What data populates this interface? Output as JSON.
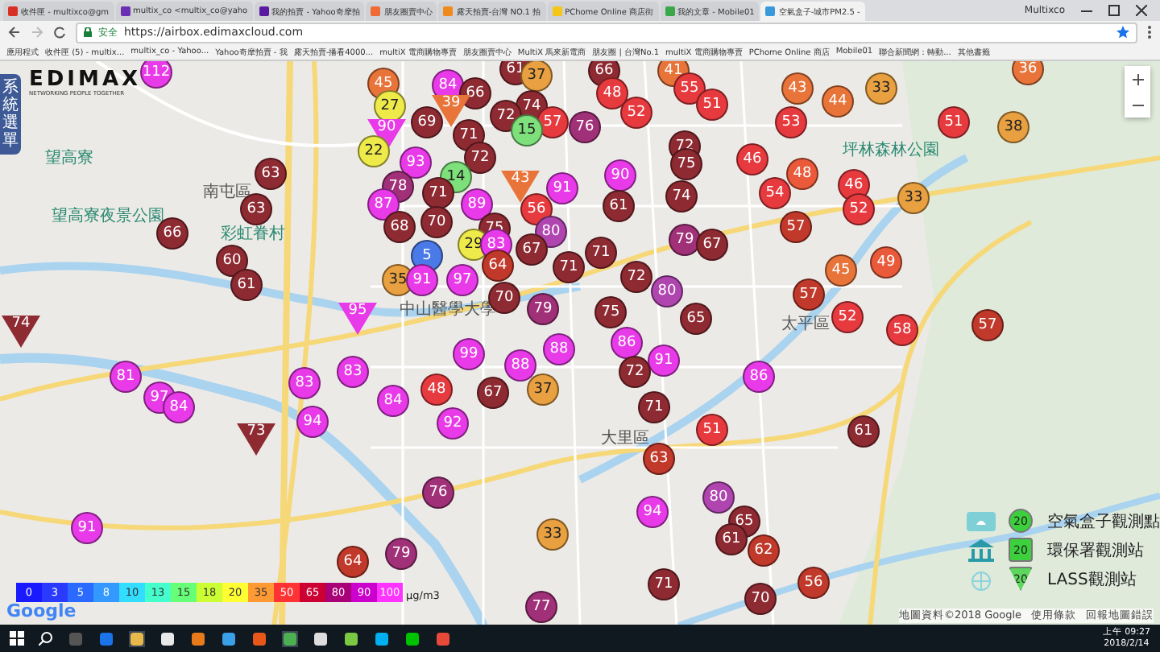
{
  "browser": {
    "tabs": [
      {
        "title": "收件匣 - multixco@gm",
        "selected": false,
        "color": "#d93025"
      },
      {
        "title": "multix_co <multix_co@yaho",
        "selected": false,
        "color": "#6b2fb3"
      },
      {
        "title": "我的拍賣 - Yahoo奇摩拍",
        "selected": false,
        "color": "#5a1aa0"
      },
      {
        "title": "朋友圈賣中心",
        "selected": false,
        "color": "#f06a35"
      },
      {
        "title": "露天拍賣-台灣 NO.1 拍",
        "selected": false,
        "color": "#f08a1a"
      },
      {
        "title": "PChome Online 商店街",
        "selected": false,
        "color": "#f5c518"
      },
      {
        "title": "我的文章 - Mobile01",
        "selected": false,
        "color": "#3aa84a"
      },
      {
        "title": "空氣盒子-城市PM2.5 -",
        "selected": true,
        "color": "#3a9ad9"
      }
    ],
    "user": "Multixco",
    "secure_label": "安全",
    "url": "https://airbox.edimaxcloud.com",
    "bookmarks": [
      "應用程式",
      "收件匣 (5) - multix...",
      "multix_co - Yahoo...",
      "Yahoo奇摩拍賣 - 我",
      "露天拍賣-播看4000...",
      "multiX 電商購物專賣",
      "朋友圈賣中心",
      "MultiX 馬來新電商",
      "朋友圈 | 台灣No.1",
      "multiX 電商購物專賣",
      "PChome Online 商店",
      "Mobile01",
      "聯合新聞網：轉動...",
      "其他書籤"
    ]
  },
  "map": {
    "logo": "EDIMAX",
    "logo_tagline": "NETWORKING PEOPLE TOGETHER",
    "menu_tab": "系統選單",
    "places": [
      {
        "name": "望高寮",
        "kind": "park"
      },
      {
        "name": "望高寮夜景公園",
        "kind": "park"
      },
      {
        "name": "南屯區",
        "kind": "district"
      },
      {
        "name": "彩虹眷村",
        "kind": "park"
      },
      {
        "name": "中山醫學大學",
        "kind": "district"
      },
      {
        "name": "坪林森林公園",
        "kind": "park"
      },
      {
        "name": "太平區",
        "kind": "district"
      },
      {
        "name": "大里區",
        "kind": "district"
      }
    ],
    "markers": [
      {
        "value": "112",
        "color": "#e83ae8",
        "kind": "circle"
      },
      {
        "value": "61",
        "color": "#8e2a32",
        "kind": "circle"
      },
      {
        "value": "37",
        "color": "#e8a040",
        "kind": "circle"
      },
      {
        "value": "45",
        "color": "#e8743a",
        "kind": "circle"
      },
      {
        "value": "84",
        "color": "#e83ae8",
        "kind": "circle"
      },
      {
        "value": "66",
        "color": "#8e2a32",
        "kind": "circle"
      },
      {
        "value": "27",
        "color": "#eeea4a",
        "kind": "circle"
      },
      {
        "value": "39",
        "color": "#e8743a",
        "kind": "triangle"
      },
      {
        "value": "74",
        "color": "#8e2a32",
        "kind": "circle"
      },
      {
        "value": "57",
        "color": "#e63a3f",
        "kind": "circle"
      },
      {
        "value": "72",
        "color": "#8e2a32",
        "kind": "circle"
      },
      {
        "value": "69",
        "color": "#8e2a32",
        "kind": "circle"
      },
      {
        "value": "71",
        "color": "#8e2a32",
        "kind": "circle"
      },
      {
        "value": "90",
        "color": "#e83ae8",
        "kind": "triangle"
      },
      {
        "value": "15",
        "color": "#7ee07a",
        "kind": "circle"
      },
      {
        "value": "22",
        "color": "#eeea4a",
        "kind": "circle"
      },
      {
        "value": "72",
        "color": "#8e2a32",
        "kind": "circle"
      },
      {
        "value": "93",
        "color": "#e83ae8",
        "kind": "circle"
      },
      {
        "value": "14",
        "color": "#7ee07a",
        "kind": "circle"
      },
      {
        "value": "78",
        "color": "#a03078",
        "kind": "circle"
      },
      {
        "value": "43",
        "color": "#e8743a",
        "kind": "triangle"
      },
      {
        "value": "71",
        "color": "#8e2a32",
        "kind": "circle"
      },
      {
        "value": "91",
        "color": "#e83ae8",
        "kind": "circle"
      },
      {
        "value": "56",
        "color": "#e63a3f",
        "kind": "circle"
      },
      {
        "value": "87",
        "color": "#e83ae8",
        "kind": "circle"
      },
      {
        "value": "89",
        "color": "#e83ae8",
        "kind": "circle"
      },
      {
        "value": "75",
        "color": "#8e2a32",
        "kind": "circle"
      },
      {
        "value": "70",
        "color": "#8e2a32",
        "kind": "circle"
      },
      {
        "value": "68",
        "color": "#8e2a32",
        "kind": "circle"
      },
      {
        "value": "80",
        "color": "#b045b0",
        "kind": "circle"
      },
      {
        "value": "5",
        "color": "#4a7ae8",
        "kind": "circle"
      },
      {
        "value": "29",
        "color": "#eeea4a",
        "kind": "circle"
      },
      {
        "value": "83",
        "color": "#e83ae8",
        "kind": "circle"
      },
      {
        "value": "67",
        "color": "#8e2a32",
        "kind": "circle"
      },
      {
        "value": "64",
        "color": "#c0392b",
        "kind": "circle"
      },
      {
        "value": "35",
        "color": "#e8a040",
        "kind": "circle"
      },
      {
        "value": "91",
        "color": "#e83ae8",
        "kind": "circle"
      },
      {
        "value": "97",
        "color": "#e83ae8",
        "kind": "circle"
      },
      {
        "value": "70",
        "color": "#8e2a32",
        "kind": "circle"
      },
      {
        "value": "71",
        "color": "#8e2a32",
        "kind": "circle"
      },
      {
        "value": "79",
        "color": "#a03078",
        "kind": "circle"
      },
      {
        "value": "63",
        "color": "#8e2a32",
        "kind": "circle"
      },
      {
        "value": "63",
        "color": "#8e2a32",
        "kind": "circle"
      },
      {
        "value": "66",
        "color": "#8e2a32",
        "kind": "circle"
      },
      {
        "value": "60",
        "color": "#8e2a32",
        "kind": "circle"
      },
      {
        "value": "61",
        "color": "#8e2a32",
        "kind": "circle"
      },
      {
        "value": "74",
        "color": "#8e2a32",
        "kind": "triangle"
      },
      {
        "value": "66",
        "color": "#8e2a32",
        "kind": "circle"
      },
      {
        "value": "41",
        "color": "#e8743a",
        "kind": "circle"
      },
      {
        "value": "48",
        "color": "#e63a3f",
        "kind": "circle"
      },
      {
        "value": "55",
        "color": "#e63a3f",
        "kind": "circle"
      },
      {
        "value": "51",
        "color": "#e63a3f",
        "kind": "circle"
      },
      {
        "value": "52",
        "color": "#e63a3f",
        "kind": "circle"
      },
      {
        "value": "76",
        "color": "#a03078",
        "kind": "circle"
      },
      {
        "value": "43",
        "color": "#e8743a",
        "kind": "circle"
      },
      {
        "value": "44",
        "color": "#e8743a",
        "kind": "circle"
      },
      {
        "value": "33",
        "color": "#e8a040",
        "kind": "circle"
      },
      {
        "value": "36",
        "color": "#e8743a",
        "kind": "circle"
      },
      {
        "value": "51",
        "color": "#e63a3f",
        "kind": "circle"
      },
      {
        "value": "38",
        "color": "#e8a040",
        "kind": "circle"
      },
      {
        "value": "53",
        "color": "#e63a3f",
        "kind": "circle"
      },
      {
        "value": "72",
        "color": "#8e2a32",
        "kind": "circle"
      },
      {
        "value": "75",
        "color": "#8e2a32",
        "kind": "circle"
      },
      {
        "value": "46",
        "color": "#e63a3f",
        "kind": "circle"
      },
      {
        "value": "90",
        "color": "#e83ae8",
        "kind": "circle"
      },
      {
        "value": "48",
        "color": "#ea5a3a",
        "kind": "circle"
      },
      {
        "value": "46",
        "color": "#e63a3f",
        "kind": "circle"
      },
      {
        "value": "74",
        "color": "#8e2a32",
        "kind": "circle"
      },
      {
        "value": "54",
        "color": "#e63a3f",
        "kind": "circle"
      },
      {
        "value": "61",
        "color": "#8e2a32",
        "kind": "circle"
      },
      {
        "value": "52",
        "color": "#e63a3f",
        "kind": "circle"
      },
      {
        "value": "33",
        "color": "#e8a040",
        "kind": "circle"
      },
      {
        "value": "57",
        "color": "#c0392b",
        "kind": "circle"
      },
      {
        "value": "79",
        "color": "#a03078",
        "kind": "circle"
      },
      {
        "value": "67",
        "color": "#8e2a32",
        "kind": "circle"
      },
      {
        "value": "71",
        "color": "#8e2a32",
        "kind": "circle"
      },
      {
        "value": "49",
        "color": "#ea5a3a",
        "kind": "circle"
      },
      {
        "value": "45",
        "color": "#e8743a",
        "kind": "circle"
      },
      {
        "value": "72",
        "color": "#8e2a32",
        "kind": "circle"
      },
      {
        "value": "80",
        "color": "#b045b0",
        "kind": "circle"
      },
      {
        "value": "57",
        "color": "#c0392b",
        "kind": "circle"
      },
      {
        "value": "75",
        "color": "#8e2a32",
        "kind": "circle"
      },
      {
        "value": "65",
        "color": "#8e2a32",
        "kind": "circle"
      },
      {
        "value": "52",
        "color": "#e63a3f",
        "kind": "circle"
      },
      {
        "value": "58",
        "color": "#e63a3f",
        "kind": "circle"
      },
      {
        "value": "57",
        "color": "#c0392b",
        "kind": "circle"
      },
      {
        "value": "95",
        "color": "#e83ae8",
        "kind": "triangle"
      },
      {
        "value": "99",
        "color": "#e83ae8",
        "kind": "circle"
      },
      {
        "value": "88",
        "color": "#e83ae8",
        "kind": "circle"
      },
      {
        "value": "88",
        "color": "#e83ae8",
        "kind": "circle"
      },
      {
        "value": "81",
        "color": "#e83ae8",
        "kind": "circle"
      },
      {
        "value": "97",
        "color": "#e83ae8",
        "kind": "circle"
      },
      {
        "value": "84",
        "color": "#e83ae8",
        "kind": "circle"
      },
      {
        "value": "83",
        "color": "#e83ae8",
        "kind": "circle"
      },
      {
        "value": "83",
        "color": "#e83ae8",
        "kind": "circle"
      },
      {
        "value": "48",
        "color": "#e63a3f",
        "kind": "circle"
      },
      {
        "value": "67",
        "color": "#8e2a32",
        "kind": "circle"
      },
      {
        "value": "37",
        "color": "#e8a040",
        "kind": "circle"
      },
      {
        "value": "84",
        "color": "#e83ae8",
        "kind": "circle"
      },
      {
        "value": "94",
        "color": "#e83ae8",
        "kind": "circle"
      },
      {
        "value": "92",
        "color": "#e83ae8",
        "kind": "circle"
      },
      {
        "value": "73",
        "color": "#8e2a32",
        "kind": "triangle"
      },
      {
        "value": "76",
        "color": "#a03078",
        "kind": "circle"
      },
      {
        "value": "91",
        "color": "#e83ae8",
        "kind": "circle"
      },
      {
        "value": "33",
        "color": "#e8a040",
        "kind": "circle"
      },
      {
        "value": "64",
        "color": "#c0392b",
        "kind": "circle"
      },
      {
        "value": "79",
        "color": "#a03078",
        "kind": "circle"
      },
      {
        "value": "77",
        "color": "#a03078",
        "kind": "circle"
      },
      {
        "value": "86",
        "color": "#e83ae8",
        "kind": "circle"
      },
      {
        "value": "91",
        "color": "#e83ae8",
        "kind": "circle"
      },
      {
        "value": "72",
        "color": "#8e2a32",
        "kind": "circle"
      },
      {
        "value": "71",
        "color": "#8e2a32",
        "kind": "circle"
      },
      {
        "value": "86",
        "color": "#e83ae8",
        "kind": "circle"
      },
      {
        "value": "51",
        "color": "#e63a3f",
        "kind": "circle"
      },
      {
        "value": "61",
        "color": "#8e2a32",
        "kind": "circle"
      },
      {
        "value": "63",
        "color": "#c0392b",
        "kind": "circle"
      },
      {
        "value": "80",
        "color": "#b045b0",
        "kind": "circle"
      },
      {
        "value": "94",
        "color": "#e83ae8",
        "kind": "circle"
      },
      {
        "value": "65",
        "color": "#8e2a32",
        "kind": "circle"
      },
      {
        "value": "61",
        "color": "#8e2a32",
        "kind": "circle"
      },
      {
        "value": "62",
        "color": "#c0392b",
        "kind": "circle"
      },
      {
        "value": "71",
        "color": "#8e2a32",
        "kind": "circle"
      },
      {
        "value": "56",
        "color": "#c0392b",
        "kind": "circle"
      },
      {
        "value": "70",
        "color": "#8e2a32",
        "kind": "circle"
      }
    ],
    "scale": [
      {
        "label": "0",
        "color": "#1a1aff"
      },
      {
        "label": "3",
        "color": "#2a3aff"
      },
      {
        "label": "5",
        "color": "#2a6aff"
      },
      {
        "label": "8",
        "color": "#3399ff"
      },
      {
        "label": "10",
        "color": "#33ddff"
      },
      {
        "label": "13",
        "color": "#44ffcc"
      },
      {
        "label": "15",
        "color": "#66ff77"
      },
      {
        "label": "18",
        "color": "#ccff33"
      },
      {
        "label": "20",
        "color": "#ffff33"
      },
      {
        "label": "35",
        "color": "#ff9933"
      },
      {
        "label": "50",
        "color": "#ff3333"
      },
      {
        "label": "65",
        "color": "#cc0033"
      },
      {
        "label": "80",
        "color": "#aa0077"
      },
      {
        "label": "90",
        "color": "#cc00cc"
      },
      {
        "label": "100",
        "color": "#ff33ff"
      }
    ],
    "unit": "μg/m3",
    "map_provider": "Google",
    "station_legend": [
      {
        "kind": "airbox",
        "sample": "20",
        "label": "空氣盒子觀測點"
      },
      {
        "kind": "epa",
        "sample": "20",
        "label": "環保署觀測站"
      },
      {
        "kind": "lass",
        "sample": "20",
        "label": "LASS觀測站"
      }
    ],
    "attribution": [
      "地圖資料©2018 Google",
      "使用條款",
      "回報地圖錯誤"
    ]
  },
  "taskbar": {
    "time": "上午 09:27",
    "date": "2018/2/14"
  }
}
